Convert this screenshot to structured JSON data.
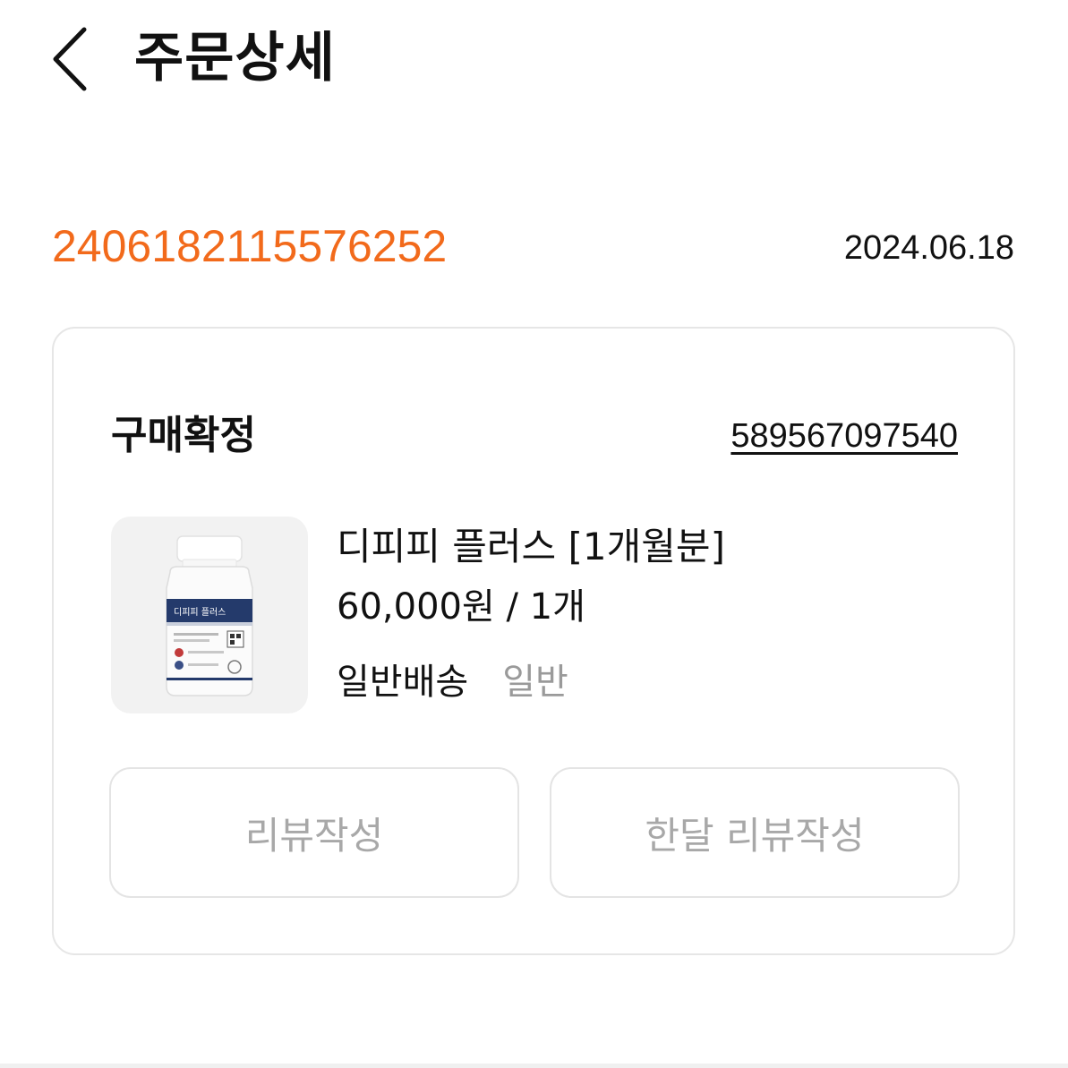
{
  "header": {
    "title": "주문상세"
  },
  "order": {
    "number": "2406182115576252",
    "date": "2024.06.18"
  },
  "card": {
    "status": "구매확정",
    "tracking_number": "589567097540",
    "product": {
      "name": "디피피 플러스 [1개월분]",
      "price_quantity": "60,000원 / 1개",
      "delivery_type": "일반배송",
      "delivery_sub": "일반",
      "label_text": "디피피 플러스"
    },
    "buttons": {
      "review": "리뷰작성",
      "month_review": "한달 리뷰작성"
    }
  },
  "colors": {
    "accent": "#f26a1b",
    "muted_text": "#a8a8a8",
    "border": "#e6e6e6"
  },
  "icons": {
    "back": "chevron-left-icon"
  }
}
